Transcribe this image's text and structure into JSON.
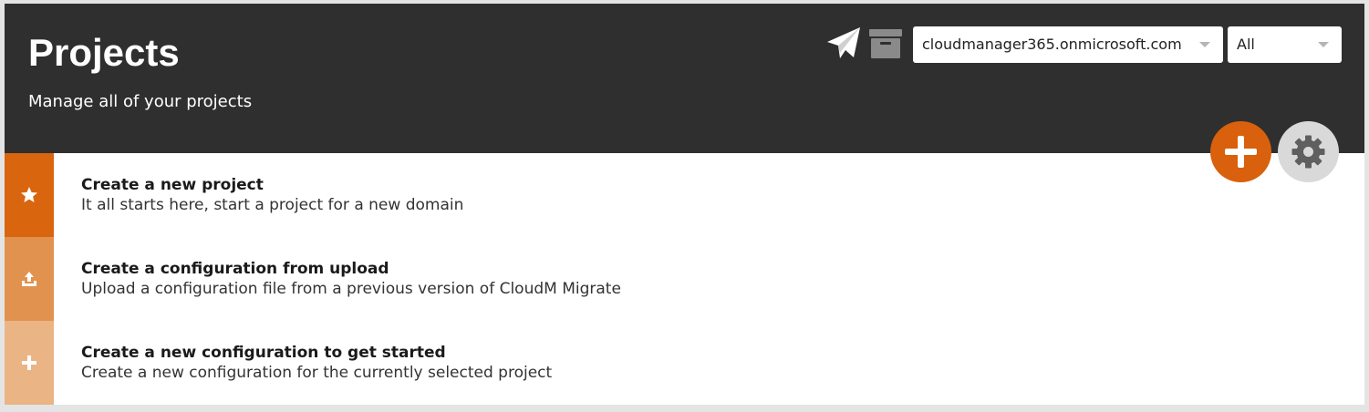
{
  "header": {
    "title": "Projects",
    "subtitle": "Manage all of your projects",
    "icons": [
      "send-icon",
      "archive-icon"
    ],
    "tenant_select": {
      "value": "cloudmanager365.onmicrosoft.com"
    },
    "filter_select": {
      "value": "All"
    }
  },
  "actions": {
    "add_icon": "plus-icon",
    "settings_icon": "gear-icon",
    "add_color": "#d9600c",
    "settings_color": "#d9d9d9"
  },
  "rows": [
    {
      "icon": "star-icon",
      "title": "Create a new project",
      "description": "It all starts here, start a project for a new domain",
      "color": "#d9650f"
    },
    {
      "icon": "upload-icon",
      "title": "Create a configuration from upload",
      "description": "Upload a configuration file from a previous version of CloudM Migrate",
      "color": "#e2924f"
    },
    {
      "icon": "plus-icon",
      "title": "Create a new configuration to get started",
      "description": "Create a new configuration for the currently selected project",
      "color": "#ebb484"
    }
  ]
}
